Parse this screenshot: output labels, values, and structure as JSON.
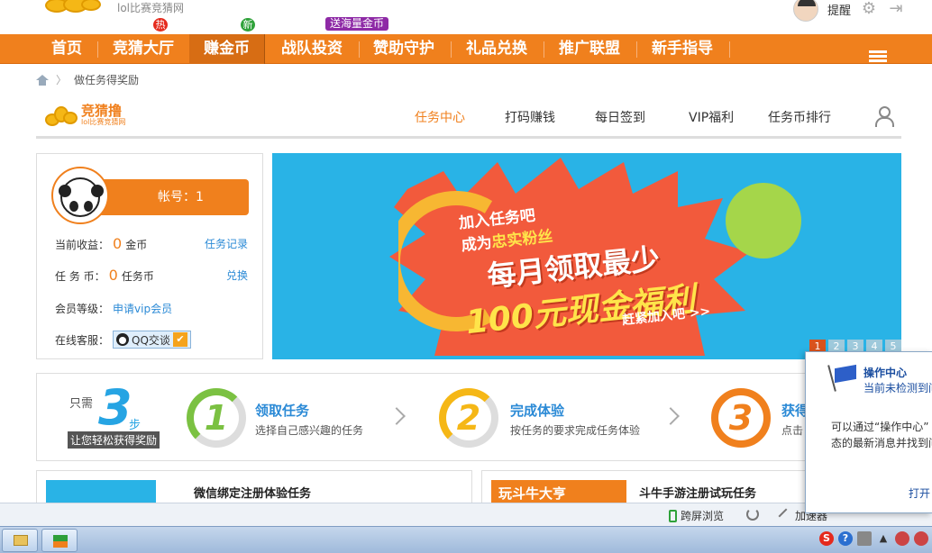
{
  "top": {
    "site_sub": "lol比赛竞猜网",
    "username": "提醒"
  },
  "nav": {
    "items": [
      "首页",
      "竞猜大厅",
      "赚金币",
      "战队投资",
      "赞助守护",
      "礼品兑换",
      "推广联盟",
      "新手指导"
    ],
    "active_index": 2,
    "badge_hot": "热",
    "badge_new": "新",
    "badge_promo": "送海量金币"
  },
  "breadcrumb": {
    "current": "做任务得奖励"
  },
  "task_header": {
    "logo_title": "竞猜撸",
    "logo_sub": "lol比赛竞猜网",
    "tabs": [
      "任务中心",
      "打码赚钱",
      "每日签到",
      "VIP福利",
      "任务币排行"
    ],
    "active_index": 0
  },
  "profile": {
    "account_label": "帐号：1",
    "income_label": "当前收益：",
    "income_value": "0",
    "income_unit": "金币",
    "income_link": "任务记录",
    "coin_label": "任 务 币：",
    "coin_value": "0",
    "coin_unit": "任务币",
    "coin_link": "兑换",
    "level_label": "会员等级：",
    "level_link": "申请vip会员",
    "service_label": "在线客服：",
    "qq_label": "QQ交谈"
  },
  "banner": {
    "line1_a": "加入任务吧",
    "line1_b": "成为",
    "line1_hl": "忠实粉丝",
    "line2": "每月领取最少",
    "line3": "100元现金福利",
    "line4": "赶紧加入吧 >>",
    "dots": [
      "1",
      "2",
      "3",
      "4",
      "5"
    ],
    "active_dot": 0
  },
  "steps": {
    "only": "只需",
    "big_num": "3",
    "bu": "步",
    "easy": "让您轻松获得奖励",
    "items": [
      {
        "num": "1",
        "title": "领取任务",
        "desc": "选择自己感兴趣的任务",
        "color": "#7bc142"
      },
      {
        "num": "2",
        "title": "完成体验",
        "desc": "按任务的要求完成任务体验",
        "color": "#f5b716"
      },
      {
        "num": "3",
        "title": "获得",
        "desc": "点击",
        "color": "#f0801d"
      }
    ]
  },
  "tasks": {
    "card1_title": "微信绑定注册体验任务",
    "card2_img": "玩斗牛大亨",
    "card2_title": "斗牛手游注册试玩任务"
  },
  "popup": {
    "title": "操作中心",
    "subtitle": "当前未检测到问",
    "body1": "可以通过“操作中心”",
    "body2": "态的最新消息并找到问",
    "link": "打开"
  },
  "statusbar": {
    "cross_screen": "跨屏浏览",
    "accelerate": "加速器"
  },
  "colors": {
    "brand_orange": "#f0801d",
    "link_blue": "#2b8ad6"
  }
}
